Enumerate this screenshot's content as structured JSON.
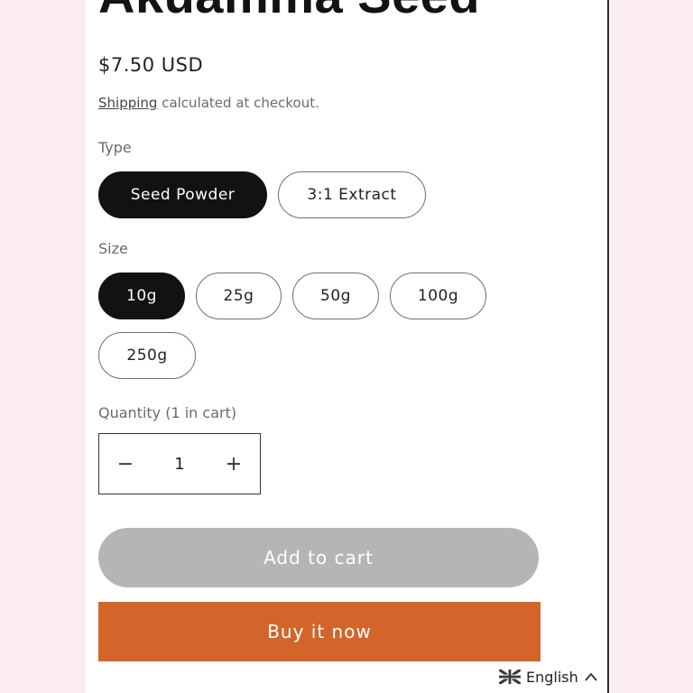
{
  "product": {
    "title": "Akuamma Seed",
    "price": "$7.50 USD",
    "shipping_link": "Shipping",
    "shipping_rest": " calculated at checkout."
  },
  "type_option": {
    "label": "Type",
    "values": [
      "Seed Powder",
      "3:1 Extract"
    ],
    "selected": "Seed Powder"
  },
  "size_option": {
    "label": "Size",
    "values": [
      "10g",
      "25g",
      "50g",
      "100g",
      "250g"
    ],
    "selected": "10g"
  },
  "quantity": {
    "label": "Quantity (1 in cart)",
    "value": "1",
    "minus": "−",
    "plus": "+"
  },
  "actions": {
    "add_to_cart": "Add to cart",
    "buy_now": "Buy it now"
  },
  "language": {
    "current": "English",
    "flag_icon": "uk-flag-icon",
    "chevron_icon": "chevron-up-icon"
  },
  "colors": {
    "page_background": "#fbedf1",
    "selected_pill": "#121212",
    "buy_now": "#d3652a",
    "add_to_cart_disabled": "#b5b5b5"
  }
}
